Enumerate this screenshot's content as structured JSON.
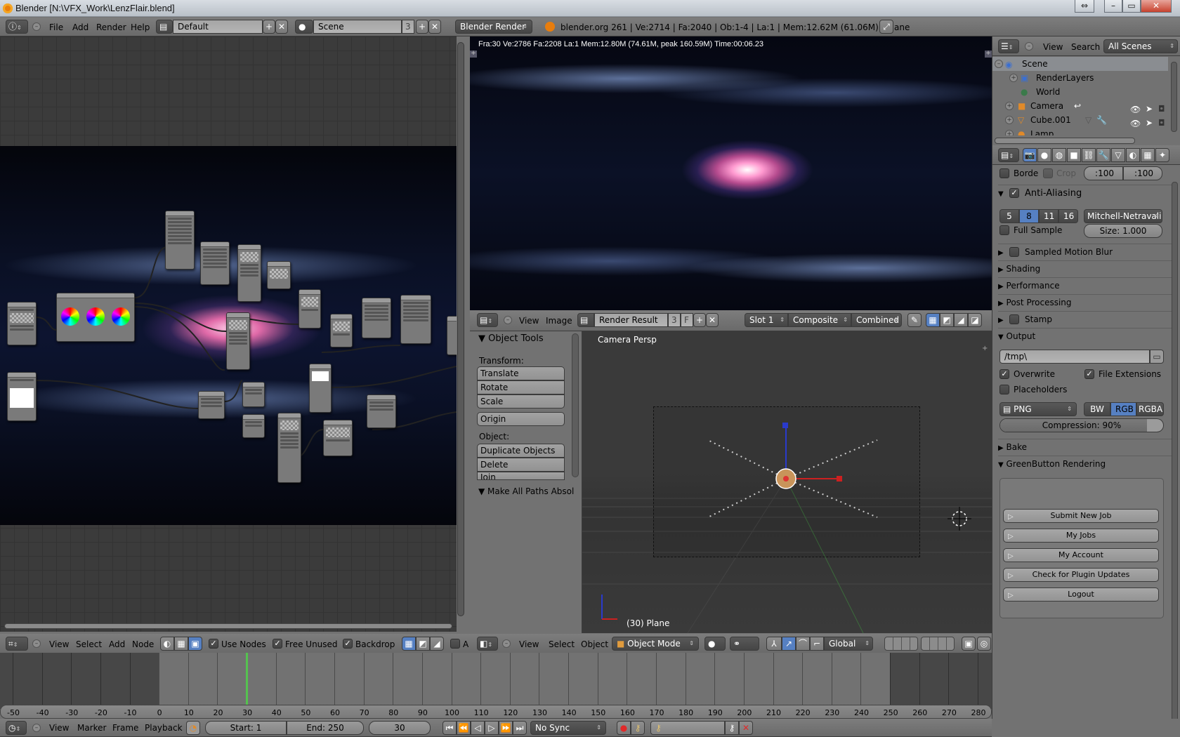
{
  "window": {
    "title": "Blender [N:\\VFX_Work\\LenzFlair.blend]",
    "controls": [
      "minimize",
      "maximize",
      "close"
    ]
  },
  "info_header": {
    "menus": [
      "File",
      "Add",
      "Render",
      "Help"
    ],
    "screen_layout": "Default",
    "scene_name": "Scene",
    "scene_users": "3",
    "render_engine": "Blender Render",
    "stats": "blender.org 261 | Ve:2714 | Fa:2040 | Ob:1-4 | La:1 | Mem:12.62M (61.06M) | Plane"
  },
  "render_view": {
    "stats": "Fra:30  Ve:2786 Fa:2208 La:1 Mem:12.80M (74.61M, peak 160.59M) Time:00:06.23"
  },
  "node_editor": {
    "menus": [
      "View",
      "Select",
      "Add",
      "Node"
    ],
    "toggles": [
      {
        "label": "Use Nodes",
        "checked": true
      },
      {
        "label": "Free Unused",
        "checked": true
      },
      {
        "label": "Backdrop",
        "checked": true
      }
    ],
    "truncated_label": "A"
  },
  "image_editor": {
    "menus": [
      "View",
      "Image"
    ],
    "image_name": "Render Result",
    "image_users": "3",
    "fake_user": "F",
    "slot": "Slot 1",
    "layer": "Composite",
    "pass": "Combined"
  },
  "tool_shelf": {
    "panel_title": "Object Tools",
    "transform_label": "Transform:",
    "transform_buttons": [
      "Translate",
      "Rotate",
      "Scale"
    ],
    "origin_button": "Origin",
    "object_label": "Object:",
    "object_buttons": [
      "Duplicate Objects",
      "Delete",
      "Join"
    ],
    "collapsed_panel": "Make All Paths Absol"
  },
  "viewport": {
    "view_name": "Camera Persp",
    "object_label": "(30) Plane",
    "menus": [
      "View",
      "Select",
      "Object"
    ],
    "mode": "Object Mode",
    "orientation": "Global"
  },
  "outliner": {
    "menus": [
      "View",
      "Search"
    ],
    "display_mode": "All Scenes",
    "items": [
      {
        "label": "Scene",
        "icon": "scene-icon"
      },
      {
        "label": "RenderLayers",
        "icon": "render-layers-icon"
      },
      {
        "label": "World",
        "icon": "world-icon"
      },
      {
        "label": "Camera",
        "icon": "camera-icon"
      },
      {
        "label": "Cube.001",
        "icon": "mesh-icon"
      },
      {
        "label": "Lamp",
        "icon": "lamp-icon"
      }
    ]
  },
  "properties": {
    "border_label": "Borde",
    "crop_label": "Crop",
    "border_min_x": ":100",
    "border_min_y": ":100",
    "antialiasing": {
      "label": "Anti-Aliasing",
      "enabled": true,
      "samples": [
        "5",
        "8",
        "11",
        "16"
      ],
      "selected_samples": "8",
      "filter": "Mitchell-Netravali",
      "full_sample_label": "Full Sample",
      "size": "Size: 1.000"
    },
    "collapsed_sections": [
      {
        "label": "Sampled Motion Blur",
        "has_checkbox": true
      },
      {
        "label": "Shading",
        "has_checkbox": false
      },
      {
        "label": "Performance",
        "has_checkbox": false
      },
      {
        "label": "Post Processing",
        "has_checkbox": false
      },
      {
        "label": "Stamp",
        "has_checkbox": true
      }
    ],
    "output": {
      "label": "Output",
      "path": "/tmp\\",
      "overwrite_label": "Overwrite",
      "overwrite": true,
      "file_extensions_label": "File Extensions",
      "file_extensions": true,
      "placeholders_label": "Placeholders",
      "placeholders": false,
      "format": "PNG",
      "color_modes": [
        "BW",
        "RGB",
        "RGBA"
      ],
      "selected_color_mode": "RGB",
      "compression": "Compression: 90%",
      "compression_value": 0.9
    },
    "bake_label": "Bake",
    "greenbutton": {
      "label": "GreenButton Rendering",
      "buttons": [
        "Submit New Job",
        "My Jobs",
        "My Account",
        "Check for Plugin Updates",
        "Logout"
      ]
    }
  },
  "timeline": {
    "menus": [
      "View",
      "Marker",
      "Frame",
      "Playback"
    ],
    "start": "Start: 1",
    "end": "End: 250",
    "current_frame": "30",
    "sync": "No Sync",
    "ruler_ticks": [
      "-50",
      "-40",
      "-30",
      "-20",
      "-10",
      "0",
      "10",
      "20",
      "30",
      "40",
      "50",
      "60",
      "70",
      "80",
      "90",
      "100",
      "110",
      "120",
      "130",
      "140",
      "150",
      "160",
      "170",
      "180",
      "190",
      "200",
      "210",
      "220",
      "230",
      "240",
      "250",
      "260",
      "270",
      "280"
    ]
  },
  "colors": {
    "accent_blue": "#5680c2",
    "current_frame_green": "#55c24f",
    "panel_gray": "#727272"
  }
}
